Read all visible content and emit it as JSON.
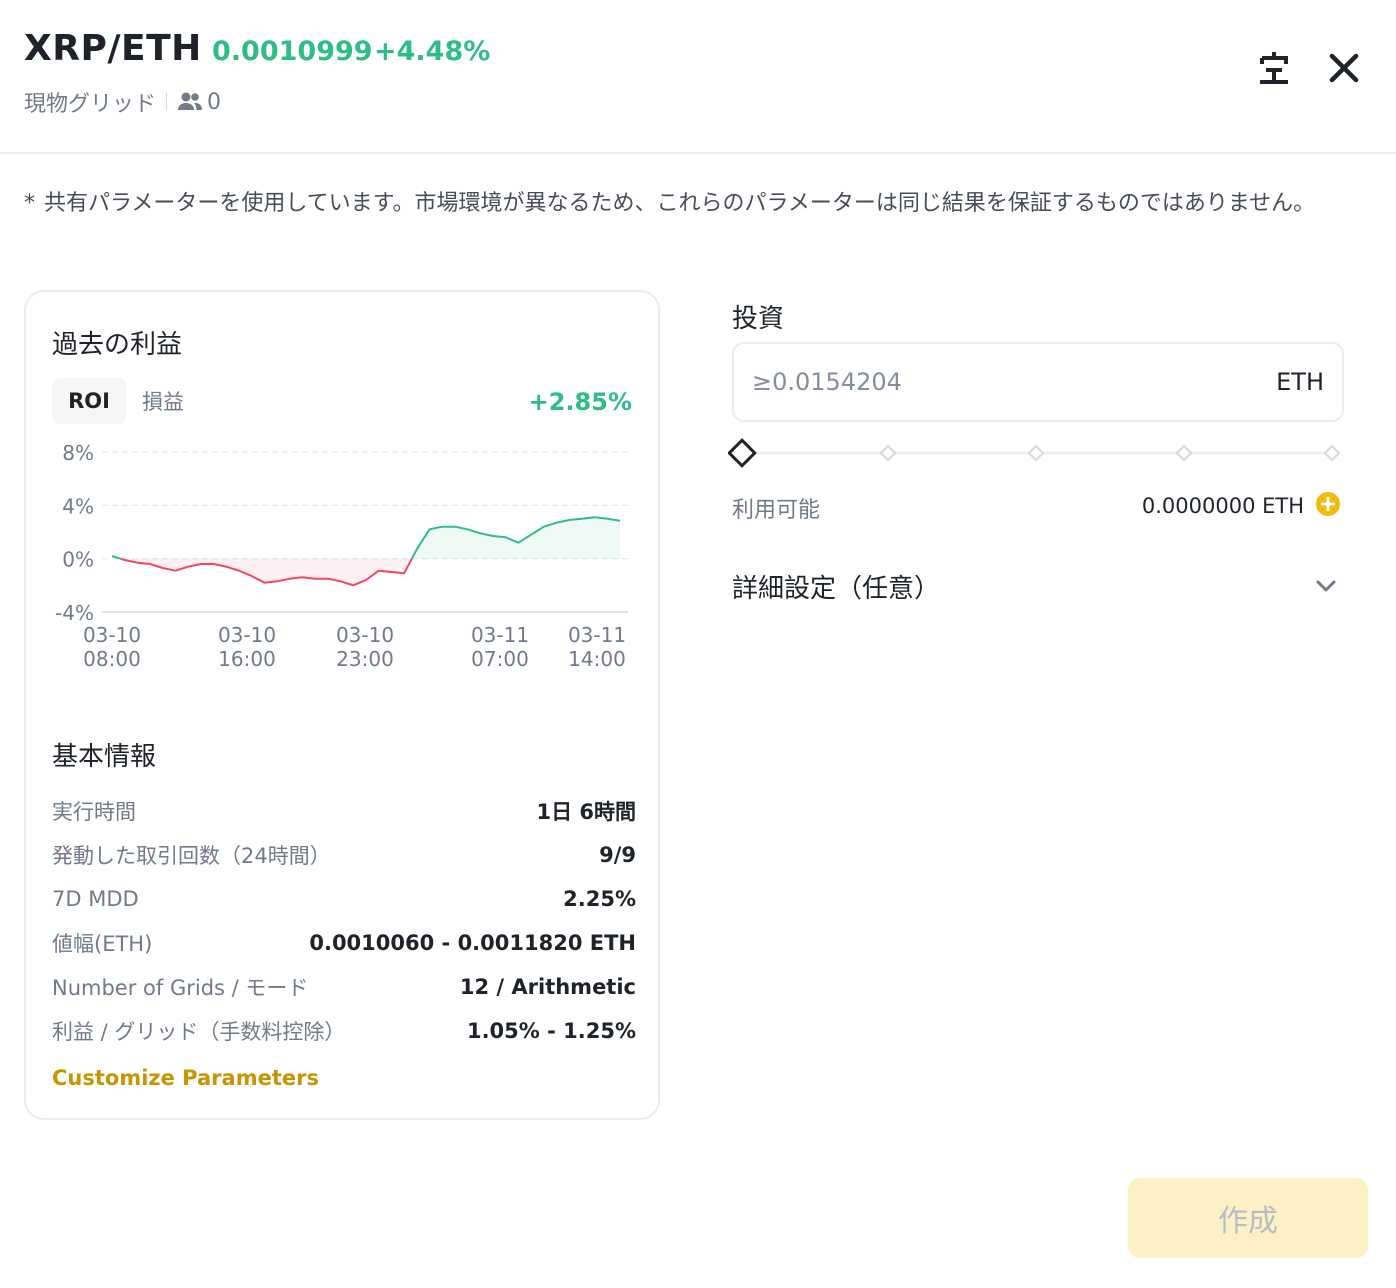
{
  "header": {
    "pair": "XRP/ETH",
    "price": "0.0010999",
    "change": "+4.48%",
    "strategy": "現物グリッド",
    "copiers": "0",
    "lang_icon": "language-icon",
    "close_icon": "close-icon"
  },
  "notice": {
    "asterisk": "*",
    "text": "共有パラメーターを使用しています。市場環境が異なるため、これらのパラメーターは同じ結果を保証するものではありません。"
  },
  "history": {
    "title": "過去の利益",
    "tabs": [
      "ROI",
      "損益"
    ],
    "roi_value": "+2.85%"
  },
  "chart_data": {
    "type": "line",
    "title": "",
    "ylim": [
      -4,
      8
    ],
    "y_ticks": [
      "8%",
      "4%",
      "0%",
      "-4%"
    ],
    "y_tick_values": [
      8,
      4,
      0,
      -4
    ],
    "x_ticks": [
      [
        "03-10",
        "08:00"
      ],
      [
        "03-10",
        "16:00"
      ],
      [
        "03-10",
        "23:00"
      ],
      [
        "03-11",
        "07:00"
      ],
      [
        "03-11",
        "14:00"
      ]
    ],
    "series": [
      {
        "values": [
          0.2,
          -0.1,
          -0.3,
          -0.4,
          -0.7,
          -0.9,
          -0.6,
          -0.4,
          -0.4,
          -0.6,
          -0.9,
          -1.3,
          -1.8,
          -1.7,
          -1.5,
          -1.4,
          -1.5,
          -1.5,
          -1.7,
          -2.0,
          -1.6,
          -0.9,
          -1.0,
          -1.1,
          0.7,
          2.2,
          2.4,
          2.4,
          2.2,
          1.9,
          1.7,
          1.6,
          1.2,
          1.8,
          2.4,
          2.7,
          2.9,
          3.0,
          3.1,
          3.0,
          2.85
        ],
        "color_positive": "#2ebd85",
        "color_negative": "#f6465d"
      }
    ]
  },
  "info": {
    "title": "基本情報",
    "rows": [
      {
        "label": "実行時間",
        "value": "1日 6時間"
      },
      {
        "label": "発動した取引回数（24時間）",
        "value": "9/9"
      },
      {
        "label": "7D MDD",
        "value": "2.25%"
      },
      {
        "label": "値幅(ETH)",
        "value": "0.0010060 - 0.0011820 ETH"
      },
      {
        "label": "Number of Grids / モード",
        "value": "12 / Arithmetic"
      },
      {
        "label": "利益 / グリッド（手数料控除）",
        "value": "1.05% - 1.25%"
      }
    ],
    "customize": "Customize Parameters"
  },
  "invest": {
    "label": "投資",
    "placeholder": "≥0.0154204",
    "unit": "ETH",
    "available_label": "利用可能",
    "available_value": "0.0000000 ETH",
    "slider_percent": 0
  },
  "advanced": {
    "label": "詳細設定（任意）"
  },
  "create_button": "作成",
  "colors": {
    "positive": "#2ebd85",
    "negative": "#f6465d",
    "accent": "#f0b90b",
    "link": "#c99400"
  }
}
